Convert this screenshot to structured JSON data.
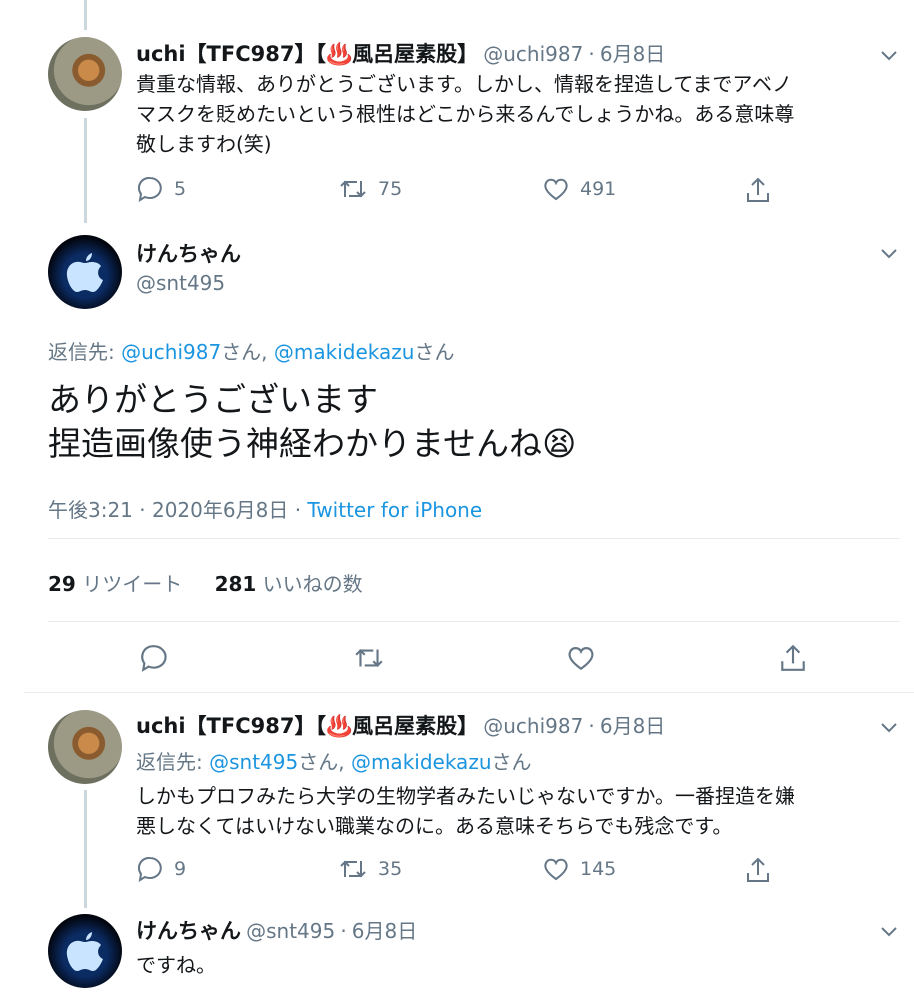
{
  "tweet1": {
    "display_name": "uchi【TFC987】【♨️風呂屋素股】",
    "handle": "@uchi987",
    "date": "6月8日",
    "text_line1": "貴重な情報、ありがとうございます。しかし、情報を捏造してまでアベノ",
    "text_line2": "マスクを貶めたいという根性はどこから来るんでしょうかね。ある意味尊",
    "text_line3": "敬しますわ(笑)",
    "replies": "5",
    "retweets": "75",
    "likes": "491"
  },
  "main": {
    "display_name": "けんちゃん",
    "handle": "@snt495",
    "reply_prefix": "返信先:",
    "reply_user1": "@uchi987",
    "reply_san1": "さん,",
    "reply_user2": "@makidekazu",
    "reply_san2": "さん",
    "text_line1": "ありがとうございます",
    "text_line2": "捏造画像使う神経わかりませんね",
    "emoji": "😫",
    "time": "午後3:21 · 2020年6月8日 ·",
    "client": "Twitter for iPhone",
    "retweet_count": "29",
    "retweet_label": "リツイート",
    "like_count": "281",
    "like_label": "いいねの数"
  },
  "tweet3": {
    "display_name": "uchi【TFC987】【♨️風呂屋素股】",
    "handle": "@uchi987",
    "date": "6月8日",
    "reply_prefix": "返信先:",
    "reply_user1": "@snt495",
    "reply_san1": "さん,",
    "reply_user2": "@makidekazu",
    "reply_san2": "さん",
    "text_line1": "しかもプロフみたら大学の生物学者みたいじゃないですか。一番捏造を嫌",
    "text_line2": "悪しなくてはいけない職業なのに。ある意味そちらでも残念です。",
    "replies": "9",
    "retweets": "35",
    "likes": "145"
  },
  "tweet4": {
    "display_name": "けんちゃん",
    "handle": "@snt495",
    "date": "6月8日",
    "text": "ですね。"
  },
  "separator": "·",
  "colors": {
    "link": "#1b95e0",
    "muted": "#657786",
    "line": "#ccd6dd",
    "divider": "#e6ecf0"
  }
}
